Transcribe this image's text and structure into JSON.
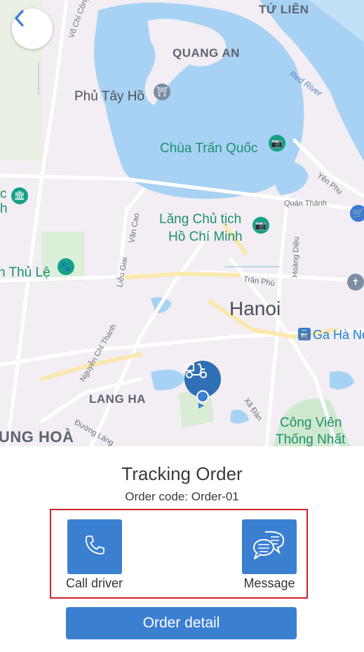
{
  "map": {
    "labels": {
      "tu_lien": "TỨ LIÊN",
      "quang_an": "QUANG AN",
      "red_river": "Red River",
      "vo_chi_cong": "Võ Chí Công",
      "phu_tay_ho": "Phủ Tây Hồ",
      "chua_tran_quoc": "Chùa Trấn Quốc",
      "yen_phu": "Yên Phụ",
      "quan_thanh": "Quán Thánh",
      "lang_line1": "Lăng Chủ tịch",
      "lang_line2": "Hồ Chí Minh",
      "van_cao": "Văn Cao",
      "thu_le": "n Thủ Lệ",
      "lieu_giai": "Liễu Giai",
      "hoang_dieu": "Hoàng Diệu",
      "tran_phu": "Trần Phú",
      "hanoi": "Hanoi",
      "ga_ha_noi": "Ga Hà No",
      "nguyen_chi_thanh": "Nguyễn Chí Thanh",
      "lang_ha": "LANG HA",
      "xa_dan": "Xã Đàn",
      "duong_lang": "Đường Láng",
      "trung_hoa": "UNG HOÀ",
      "cong_vien_line1": "Công Viên",
      "cong_vien_line2": "Thống Nhất",
      "left_c": "c",
      "left_h": "h"
    }
  },
  "panel": {
    "title": "Tracking Order",
    "order_code": "Order code: Order-01",
    "call_label": "Call driver",
    "message_label": "Message",
    "order_detail_label": "Order detail"
  },
  "colors": {
    "accent": "#3b7fd1",
    "highlight_border": "#d0212b",
    "water": "#a7d2f4",
    "poi_green": "#1e8f6e"
  },
  "icons": {
    "back": "chevron-left-icon",
    "call": "phone-icon",
    "message": "chat-bubbles-icon",
    "driver": "scooter-delivery-icon"
  }
}
